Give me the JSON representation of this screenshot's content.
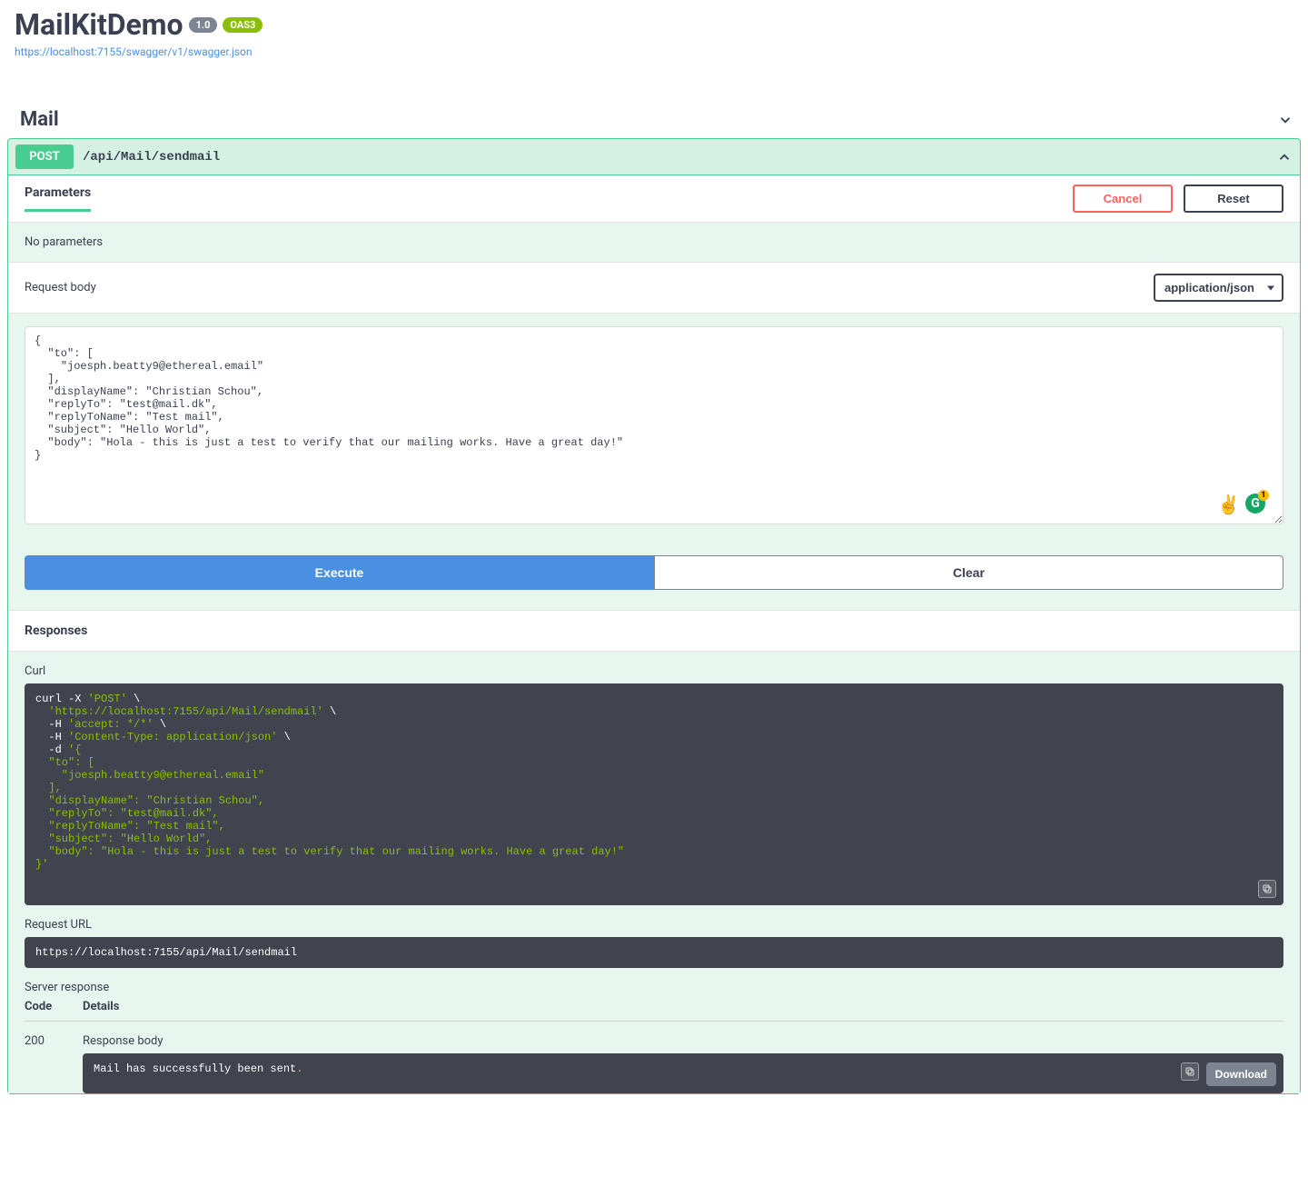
{
  "header": {
    "title": "MailKitDemo",
    "version": "1.0",
    "oas": "OAS3",
    "spec_url": "https://localhost:7155/swagger/v1/swagger.json"
  },
  "tag": {
    "name": "Mail"
  },
  "operation": {
    "method": "POST",
    "path": "/api/Mail/sendmail",
    "parameters_tab": "Parameters",
    "cancel": "Cancel",
    "reset": "Reset",
    "no_params": "No parameters",
    "request_body_label": "Request body",
    "content_type": "application/json",
    "body_json": "{\n  \"to\": [\n    \"joesph.beatty9@ethereal.email\"\n  ],\n  \"displayName\": \"Christian Schou\",\n  \"replyTo\": \"test@mail.dk\",\n  \"replyToName\": \"Test mail\",\n  \"subject\": \"Hello World\",\n  \"body\": \"Hola - this is just a test to verify that our mailing works. Have a great day!\"\n}",
    "execute": "Execute",
    "clear": "Clear"
  },
  "responses": {
    "header": "Responses",
    "curl_label": "Curl",
    "curl": {
      "l1a": "curl -X ",
      "l1b": "'POST'",
      "l1c": " \\",
      "l2a": "  ",
      "l2b": "'https://localhost:7155/api/Mail/sendmail'",
      "l2c": " \\",
      "l3a": "  -H ",
      "l3b": "'accept: */*'",
      "l3c": " \\",
      "l4a": "  -H ",
      "l4b": "'Content-Type: application/json'",
      "l4c": " \\",
      "l5a": "  -d ",
      "l5b": "'{",
      "l6": "  \"to\": [",
      "l7": "    \"joesph.beatty9@ethereal.email\"",
      "l8": "  ],",
      "l9": "  \"displayName\": \"Christian Schou\",",
      "l10": "  \"replyTo\": \"test@mail.dk\",",
      "l11": "  \"replyToName\": \"Test mail\",",
      "l12": "  \"subject\": \"Hello World\",",
      "l13": "  \"body\": \"Hola - this is just a test to verify that our mailing works. Have a great day!\"",
      "l14": "}'"
    },
    "request_url_label": "Request URL",
    "request_url": "https://localhost:7155/api/Mail/sendmail",
    "server_response_label": "Server response",
    "cols": {
      "code": "Code",
      "details": "Details"
    },
    "row": {
      "code": "200",
      "body_label": "Response body",
      "body_text": "Mail has successfully been sent",
      "download": "Download"
    }
  },
  "overlay": {
    "badge_count": "1"
  }
}
